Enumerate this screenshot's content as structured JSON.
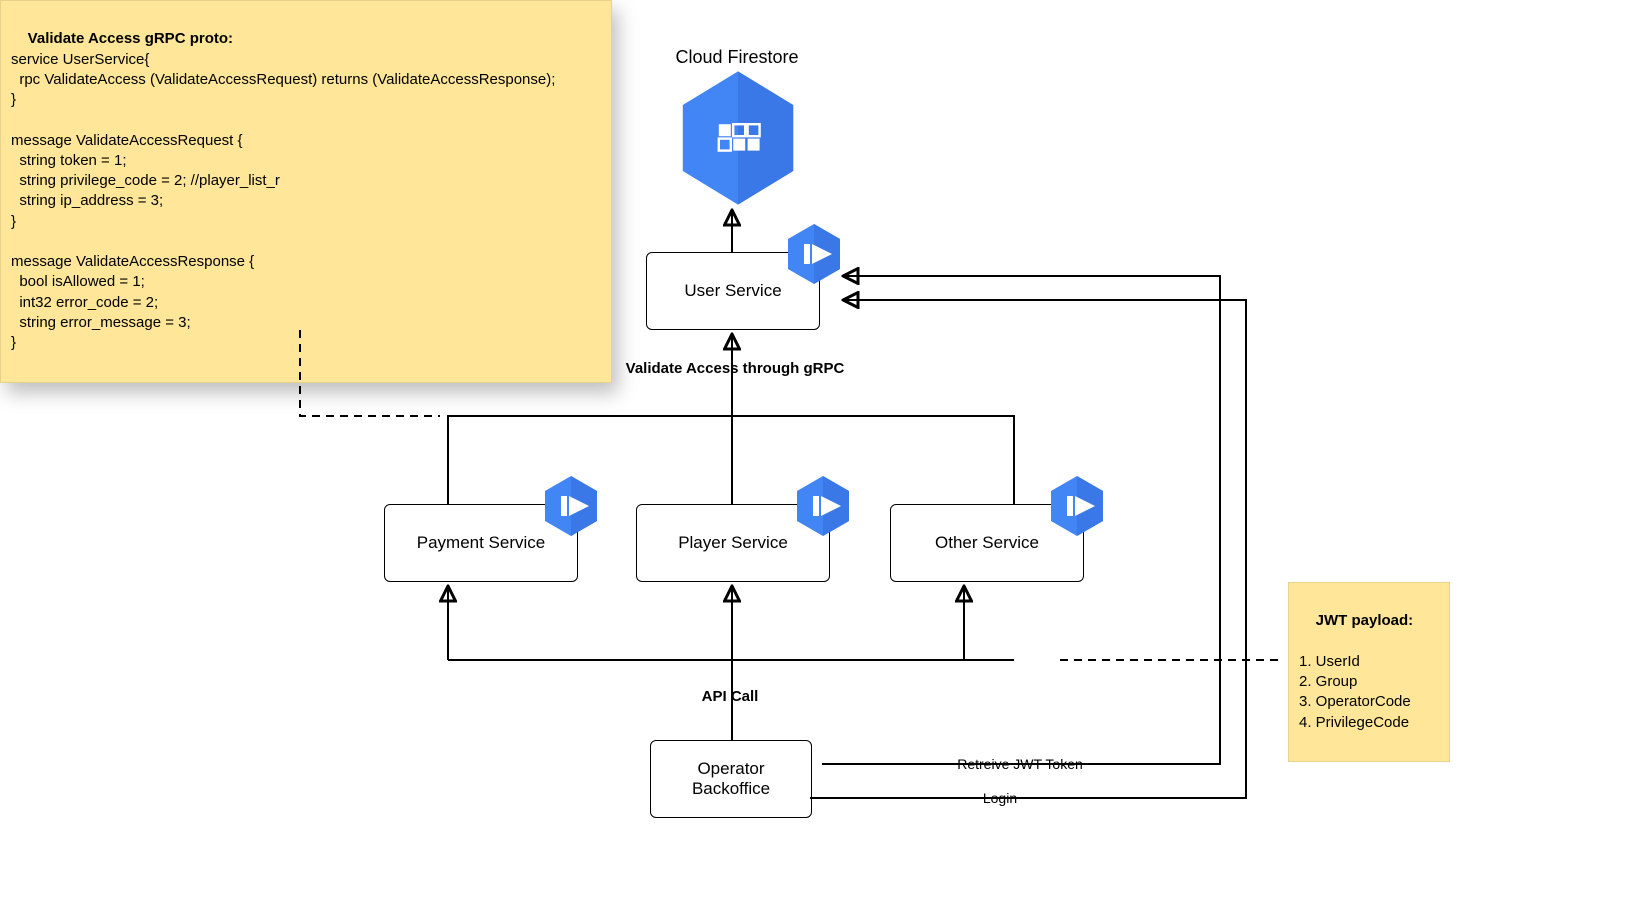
{
  "notes": {
    "proto": {
      "title": "Validate Access gRPC proto:",
      "body": "service UserService{\n  rpc ValidateAccess (ValidateAccessRequest) returns (ValidateAccessResponse);\n}\n\nmessage ValidateAccessRequest {\n  string token = 1;\n  string privilege_code = 2; //player_list_r\n  string ip_address = 3;\n}\n\nmessage ValidateAccessResponse {\n  bool isAllowed = 1;\n  int32 error_code = 2;\n  string error_message = 3;\n}"
    },
    "jwt": {
      "title": "JWT payload:",
      "body": "1. UserId\n2. Group\n3. OperatorCode\n4. PrivilegeCode"
    }
  },
  "nodes": {
    "firestore": "Cloud Firestore",
    "user_service": "User Service",
    "payment_service": "Payment Service",
    "player_service": "Player Service",
    "other_service": "Other Service",
    "operator_backoffice": "Operator\nBackoffice"
  },
  "edges": {
    "validate_grpc": "Validate Access through gRPC",
    "api_call": "API Call",
    "retrieve_jwt": "Retreive JWT Token",
    "login": "Login"
  }
}
